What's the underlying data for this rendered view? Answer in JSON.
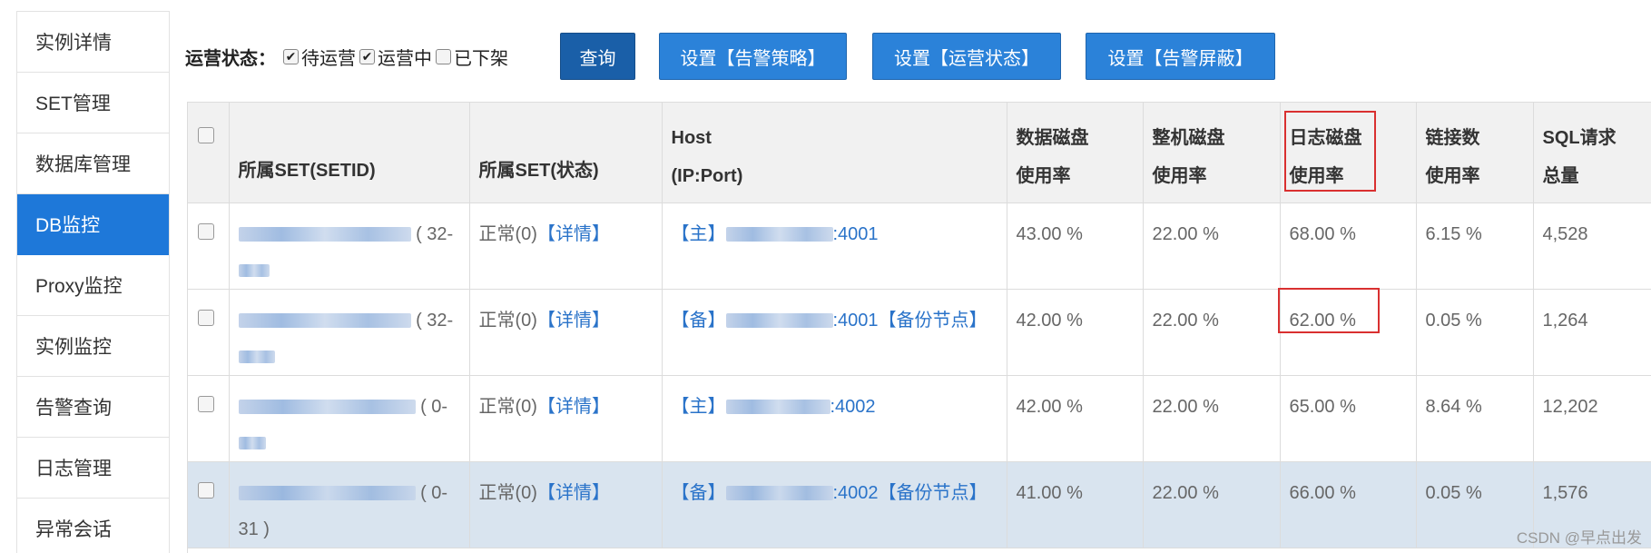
{
  "sidebar": {
    "items": [
      {
        "label": "实例详情"
      },
      {
        "label": "SET管理"
      },
      {
        "label": "数据库管理"
      },
      {
        "label": "DB监控",
        "active": true
      },
      {
        "label": "Proxy监控"
      },
      {
        "label": "实例监控"
      },
      {
        "label": "告警查询"
      },
      {
        "label": "日志管理"
      },
      {
        "label": "异常会话"
      }
    ]
  },
  "toolbar": {
    "filter_label": "运营状态：",
    "checkboxes": [
      {
        "label": "待运营",
        "checked": true
      },
      {
        "label": "运营中",
        "checked": true
      },
      {
        "label": "已下架",
        "checked": false
      }
    ],
    "buttons": {
      "query": "查询",
      "alarm_policy": "设置【告警策略】",
      "ops_status": "设置【运营状态】",
      "alarm_mask": "设置【告警屏蔽】"
    }
  },
  "table": {
    "headers": {
      "set_id": "所属SET(SETID)",
      "set_status": "所属SET(状态)",
      "host_line1": "Host",
      "host_line2": "(IP:Port)",
      "data_disk_line1": "数据磁盘",
      "data_disk_line2": "使用率",
      "machine_disk_line1": "整机磁盘",
      "machine_disk_line2": "使用率",
      "log_disk_line1": "日志磁盘",
      "log_disk_line2": "使用率",
      "conn_line1": "链接数",
      "conn_line2": "使用率",
      "sql_line1": "SQL请求",
      "sql_line2": "总量"
    },
    "rows": [
      {
        "set_suffix": "( 32-",
        "set_status": "正常(0)",
        "detail": "【详情】",
        "role": "【主】",
        "port": ":4001",
        "backup": "",
        "data_disk": "43.00 %",
        "machine_disk": "22.00 %",
        "log_disk": "68.00 %",
        "conn": "6.15 %",
        "sql": "4,528"
      },
      {
        "set_suffix": "( 32-",
        "set_status": "正常(0)",
        "detail": "【详情】",
        "role": "【备】",
        "port": ":4001",
        "backup": "【备份节点】",
        "data_disk": "42.00 %",
        "machine_disk": "22.00 %",
        "log_disk": "62.00 %",
        "conn": "0.05 %",
        "sql": "1,264"
      },
      {
        "set_suffix": "( 0-",
        "set_status": "正常(0)",
        "detail": "【详情】",
        "role": "【主】",
        "port": ":4002",
        "backup": "",
        "data_disk": "42.00 %",
        "machine_disk": "22.00 %",
        "log_disk": "65.00 %",
        "conn": "8.64 %",
        "sql": "12,202"
      },
      {
        "set_suffix": "( 0-",
        "set_suffix2": "31 )",
        "set_status": "正常(0)",
        "detail": "【详情】",
        "role": "【备】",
        "port": ":4002",
        "backup": "【备份节点】",
        "data_disk": "41.00 %",
        "machine_disk": "22.00 %",
        "log_disk": "66.00 %",
        "conn": "0.05 %",
        "sql": "1,576"
      }
    ]
  },
  "watermark": "CSDN @早点出发"
}
